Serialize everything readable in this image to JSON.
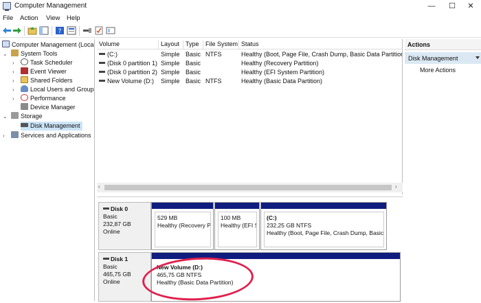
{
  "window": {
    "title": "Computer Management",
    "min": "—",
    "max": "☐",
    "close": "✕"
  },
  "menu": [
    "File",
    "Action",
    "View",
    "Help"
  ],
  "tree": {
    "root": "Computer Management (Local",
    "system_tools": "System Tools",
    "task_scheduler": "Task Scheduler",
    "event_viewer": "Event Viewer",
    "shared_folders": "Shared Folders",
    "local_users": "Local Users and Groups",
    "performance": "Performance",
    "device_manager": "Device Manager",
    "storage": "Storage",
    "disk_management": "Disk Management",
    "services": "Services and Applications"
  },
  "volume_table": {
    "headers": [
      "Volume",
      "Layout",
      "Type",
      "File System",
      "Status"
    ],
    "rows": [
      [
        "(C:)",
        "Simple",
        "Basic",
        "NTFS",
        "Healthy (Boot, Page File, Crash Dump, Basic Data Partition)"
      ],
      [
        "(Disk 0 partition 1)",
        "Simple",
        "Basic",
        "",
        "Healthy (Recovery Partition)"
      ],
      [
        "(Disk 0 partition 2)",
        "Simple",
        "Basic",
        "",
        "Healthy (EFI System Partition)"
      ],
      [
        "New Volume (D:)",
        "Simple",
        "Basic",
        "NTFS",
        "Healthy (Basic Data Partition)"
      ]
    ]
  },
  "disks": [
    {
      "name": "Disk 0",
      "type": "Basic",
      "size": "232,87 GB",
      "state": "Online",
      "partitions": [
        {
          "title": "",
          "size": "529 MB",
          "status": "Healthy (Recovery P"
        },
        {
          "title": "",
          "size": "100 MB",
          "status": "Healthy (EFI Sy"
        },
        {
          "title": "(C:)",
          "size": "232,25 GB NTFS",
          "status": "Healthy (Boot, Page File, Crash Dump, Basic Data Partition)"
        }
      ]
    },
    {
      "name": "Disk 1",
      "type": "Basic",
      "size": "465,75 GB",
      "state": "Online",
      "partitions": [
        {
          "title": "New Volume  (D:)",
          "size": "465,75 GB NTFS",
          "status": "Healthy (Basic Data Partition)"
        }
      ]
    }
  ],
  "actions": {
    "header": "Actions",
    "section": "Disk Management",
    "more": "More Actions"
  },
  "colors": {
    "partition_bar": "#0f1d7f",
    "selection": "#cce4f7",
    "annotation_circle": "#e0204e"
  }
}
